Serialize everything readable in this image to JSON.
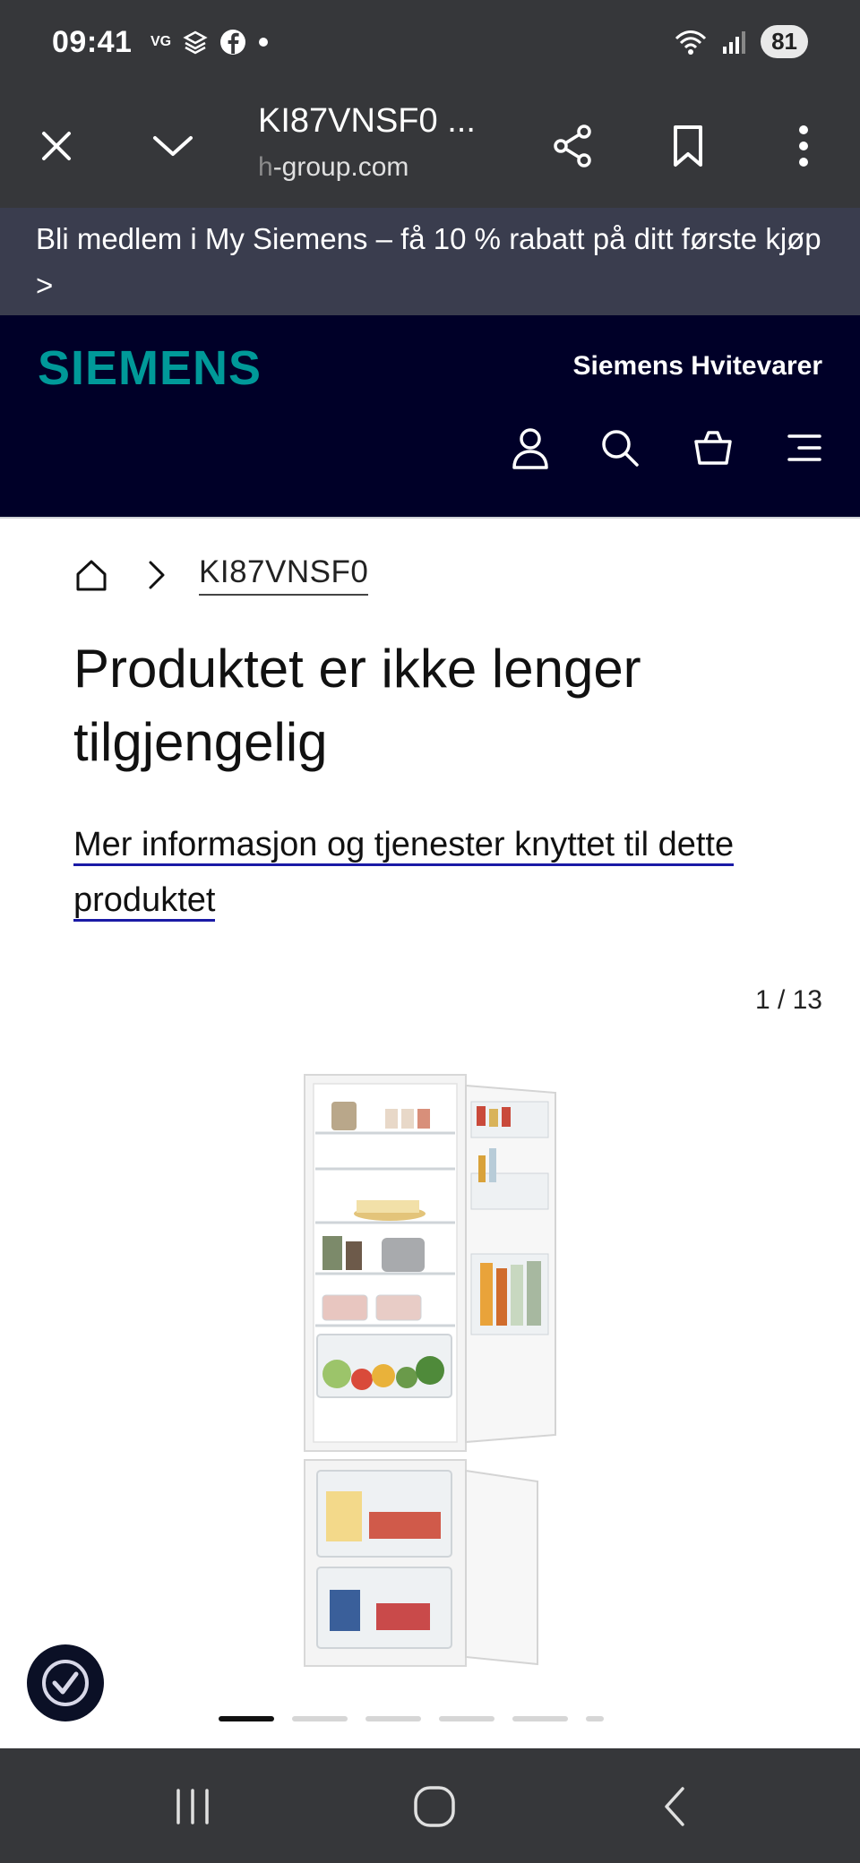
{
  "status_bar": {
    "time": "09:41",
    "app_icons": [
      "vg-icon",
      "layers-icon",
      "facebook-icon",
      "dot-icon"
    ],
    "battery": "81"
  },
  "browser": {
    "page_title": "KI87VNSF0 ...",
    "url_prefix": "h",
    "url_rest": "-group.com"
  },
  "promo": {
    "text": "Bli medlem i My Siemens – få 10 % rabatt på ditt første kjøp >"
  },
  "header": {
    "logo": "SIEMENS",
    "brand": "Siemens Hvitevarer",
    "icons": [
      "user-icon",
      "search-icon",
      "basket-icon",
      "menu-icon"
    ]
  },
  "breadcrumb": {
    "item": "KI87VNSF0"
  },
  "main": {
    "title": "Produktet er ikke lenger tilgjengelig",
    "info_link": "Mer informasjon og tjenester knyttet til dette produktet",
    "gallery_counter": "1 / 13",
    "gallery_total": 13,
    "gallery_current": 1
  },
  "colors": {
    "brand_teal": "#009999",
    "header_bg": "#000028",
    "promo_bg": "#3a3d4e",
    "chrome_bg": "#36373a",
    "link_underline": "#1a1aa6"
  }
}
